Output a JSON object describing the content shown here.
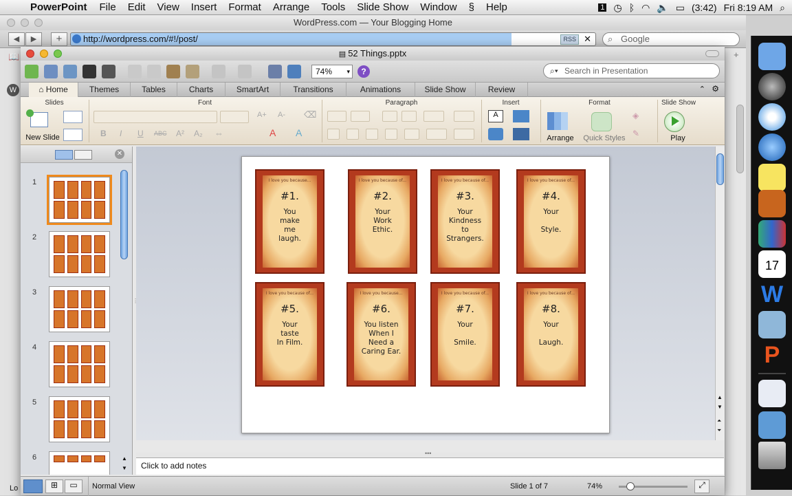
{
  "menubar": {
    "app": "PowerPoint",
    "items": [
      "File",
      "Edit",
      "View",
      "Insert",
      "Format",
      "Arrange",
      "Tools",
      "Slide Show",
      "Window",
      "Help"
    ],
    "battery": "(3:42)",
    "clock": "Fri 8:19 AM"
  },
  "safari": {
    "title": "WordPress.com — Your Blogging Home",
    "url": "http://wordpress.com/#!/post/",
    "rss": "RSS",
    "search_placeholder": "Google",
    "status_left": "Lo"
  },
  "ppt": {
    "title": "52 Things.pptx",
    "zoom": "74%",
    "search_placeholder": "Search in Presentation",
    "tabs": [
      "Home",
      "Themes",
      "Tables",
      "Charts",
      "SmartArt",
      "Transitions",
      "Animations",
      "Slide Show",
      "Review"
    ],
    "ribbon_groups": {
      "slides": "Slides",
      "font": "Font",
      "paragraph": "Paragraph",
      "insert": "Insert",
      "format": "Format",
      "slideshow": "Slide Show"
    },
    "ribbon_buttons": {
      "new_slide": "New Slide",
      "arrange": "Arrange",
      "quick_styles": "Quick Styles",
      "play": "Play"
    },
    "font_buttons": {
      "bold": "B",
      "italic": "I",
      "underline": "U",
      "strike": "ABC",
      "superscript": "A²",
      "subscript": "A₂",
      "increase": "A+",
      "decrease": "A-"
    },
    "thumb_numbers": [
      "1",
      "2",
      "3",
      "4",
      "5",
      "6"
    ],
    "cards": [
      {
        "top": "I love you because...",
        "num": "#1.",
        "text": "You\nmake\nme\nlaugh."
      },
      {
        "top": "I love you because of...",
        "num": "#2.",
        "text": "Your\nWork\nEthic."
      },
      {
        "top": "I love you because of...",
        "num": "#3.",
        "text": "Your\nKindness\nto\nStrangers."
      },
      {
        "top": "I love you because of...",
        "num": "#4.",
        "text": "Your\n\nStyle."
      },
      {
        "top": "I love you because of...",
        "num": "#5.",
        "text": "Your\ntaste\nIn Film."
      },
      {
        "top": "I love you because...",
        "num": "#6.",
        "text": "You listen\nWhen I\nNeed a\nCaring Ear."
      },
      {
        "top": "I love you because of...",
        "num": "#7.",
        "text": "Your\n\nSmile."
      },
      {
        "top": "I love you because of...",
        "num": "#8.",
        "text": "Your\n\nLaugh."
      }
    ],
    "notes_placeholder": "Click to add notes",
    "status": {
      "view": "Normal View",
      "slide": "Slide 1 of 7",
      "zoom": "74%"
    }
  },
  "colors": {
    "card_border": "#b33a1e",
    "card_paper": "#f7d9a0",
    "thumb_selected": "#f08a1c"
  }
}
